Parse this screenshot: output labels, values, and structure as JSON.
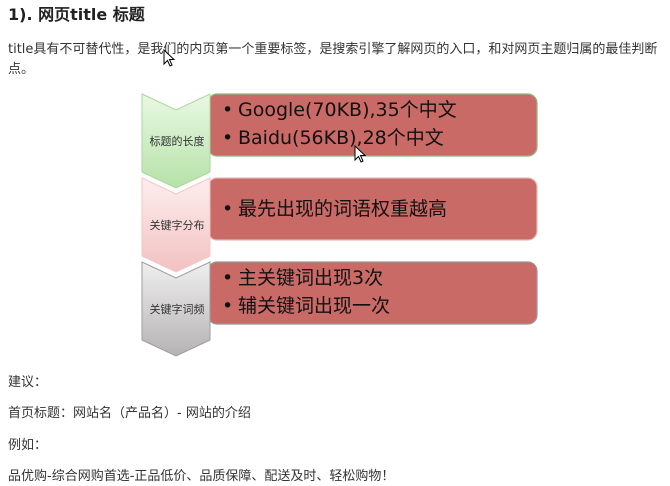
{
  "heading": "1). 网页title 标题",
  "paragraph": "title具有不可替代性，是我们的内页第一个重要标签，是搜索引擎了解网页的入口，和对网页主题归属的最佳判断点。",
  "diagram": {
    "rows": [
      {
        "label": "标题的长度",
        "chevron_color": "#cfeec6",
        "bullets": [
          "Google(70KB),35个中文",
          "Baidu(56KB),28个中文"
        ]
      },
      {
        "label": "关键字分布",
        "chevron_color": "#f8d6d6",
        "bullets": [
          "最先出现的词语权重越高"
        ]
      },
      {
        "label": "关键字词频",
        "chevron_color": "#d4d2d2",
        "bullets": [
          "主关键词出现3次",
          "辅关键词出现一次"
        ]
      }
    ],
    "bullet_char": "•",
    "box_color": "#c96a66"
  },
  "lines": {
    "suggest": "建议：",
    "home_title": "首页标题：网站名（产品名）- 网站的介绍",
    "example_label": "例如：",
    "example": "品优购-综合网购首选-正品低价、品质保障、配送及时、轻松购物！"
  }
}
